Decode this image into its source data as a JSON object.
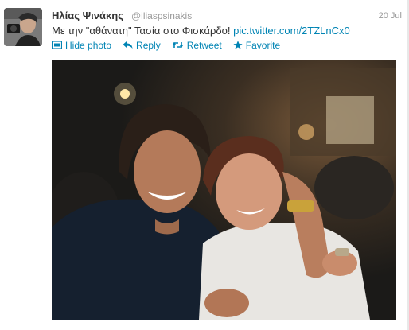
{
  "tweet": {
    "name": "Ηλίας Ψινάκης",
    "handle": "@iliaspsinakis",
    "date": "20 Jul",
    "text": "Με την \"αθάνατη\" Τασία στο Φισκάρδο!",
    "link": "pic.twitter.com/2TZLnCx0"
  },
  "actions": {
    "hide_photo": "Hide photo",
    "reply": "Reply",
    "retweet": "Retweet",
    "favorite": "Favorite"
  },
  "icons": {
    "hide_photo": "photo-icon",
    "reply": "reply-arrow-icon",
    "retweet": "retweet-icon",
    "favorite": "star-icon"
  },
  "colors": {
    "link": "#0084b4",
    "name": "#333333",
    "muted": "#999999"
  }
}
